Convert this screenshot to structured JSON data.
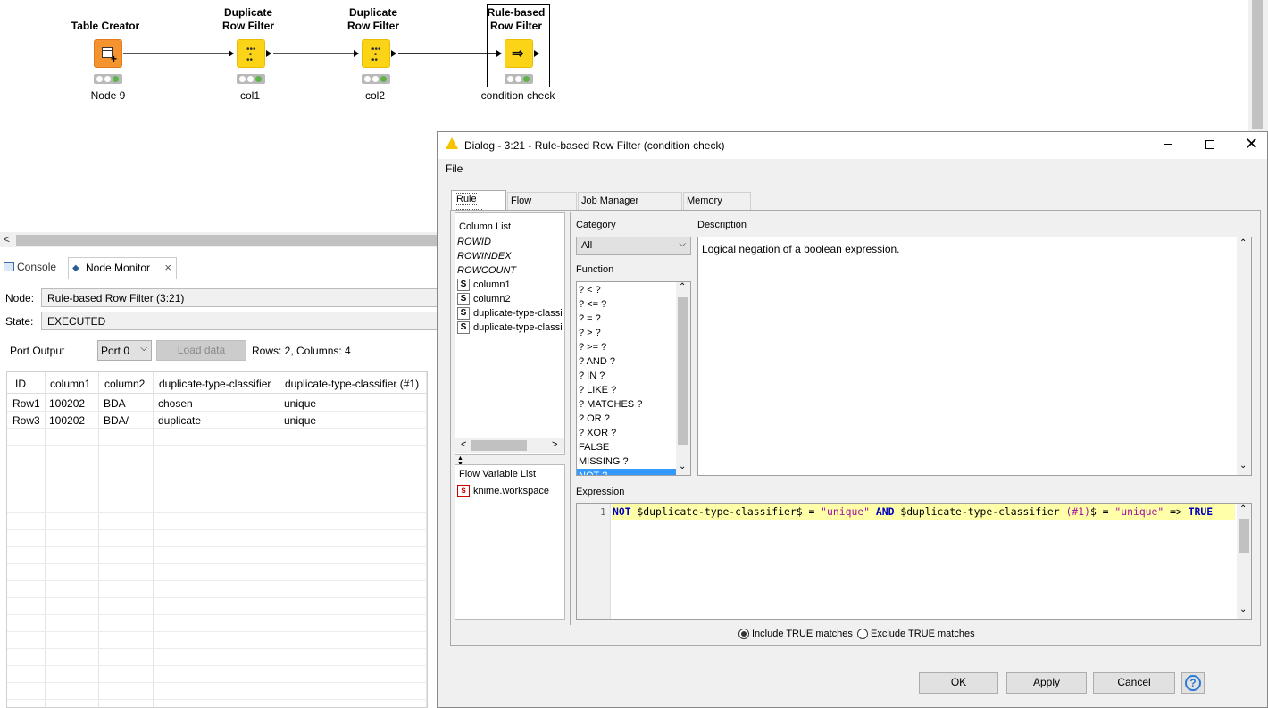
{
  "workflow": {
    "nodes": [
      {
        "title": "Table Creator",
        "label": "Node 9"
      },
      {
        "title": "Duplicate\nRow Filter",
        "label": "col1"
      },
      {
        "title": "Duplicate\nRow Filter",
        "label": "col2"
      },
      {
        "title": "Rule-based\nRow Filter",
        "label": "condition check"
      }
    ]
  },
  "bottom_panel": {
    "tabs": [
      "Console",
      "Node Monitor"
    ],
    "node_label": "Node:",
    "node_value": "Rule-based Row Filter  (3:21)",
    "state_label": "State:",
    "state_value": "EXECUTED",
    "port_output_label": "Port Output",
    "port_select": "Port 0",
    "load_data": "Load data",
    "rows_cols": "Rows: 2, Columns: 4",
    "table": {
      "headers": [
        "ID",
        "column1",
        "column2",
        "duplicate-type-classifier",
        "duplicate-type-classifier (#1)"
      ],
      "rows": [
        [
          "Row1",
          "100202",
          "BDA",
          "chosen",
          "unique"
        ],
        [
          "Row3",
          "100202",
          "BDA/",
          "duplicate",
          "unique"
        ]
      ]
    }
  },
  "dialog": {
    "title": "Dialog - 3:21 - Rule-based Row Filter (condition check)",
    "menu": "File",
    "tabs": [
      "Rule Editor",
      "Flow Variables",
      "Job Manager Selection",
      "Memory Policy"
    ],
    "column_list_label": "Column List",
    "column_list": [
      {
        "name": "ROWID",
        "italic": true
      },
      {
        "name": "ROWINDEX",
        "italic": true
      },
      {
        "name": "ROWCOUNT",
        "italic": true
      },
      {
        "name": "column1",
        "type": "S"
      },
      {
        "name": "column2",
        "type": "S"
      },
      {
        "name": "duplicate-type-classi",
        "type": "S"
      },
      {
        "name": "duplicate-type-classi",
        "type": "S"
      }
    ],
    "flow_variable_label": "Flow Variable List",
    "flow_variables": [
      "knime.workspace"
    ],
    "category_label": "Category",
    "category_value": "All",
    "function_label": "Function",
    "functions": [
      "? < ?",
      "? <= ?",
      "? = ?",
      "? > ?",
      "? >= ?",
      "? AND ?",
      "? IN ?",
      "? LIKE ?",
      "? MATCHES ?",
      "? OR ?",
      "? XOR ?",
      "FALSE",
      "MISSING ?",
      "NOT ?"
    ],
    "description_label": "Description",
    "description_text": "Logical negation of a boolean expression.",
    "expression_label": "Expression",
    "expression_line_no": "1",
    "expression": {
      "k1": "NOT",
      "c1": " $duplicate-type-classifier$ = ",
      "s1": "\"unique\"",
      "k2": " AND",
      "c2": " $duplicate-type-classifier ",
      "s2": "(#1)",
      "c3": "$ = ",
      "s3": "\"unique\"",
      "c4": " => ",
      "k3": "TRUE"
    },
    "radio_include": "Include TRUE matches",
    "radio_exclude": "Exclude TRUE matches",
    "ok": "OK",
    "apply": "Apply",
    "cancel": "Cancel",
    "help": "?"
  }
}
